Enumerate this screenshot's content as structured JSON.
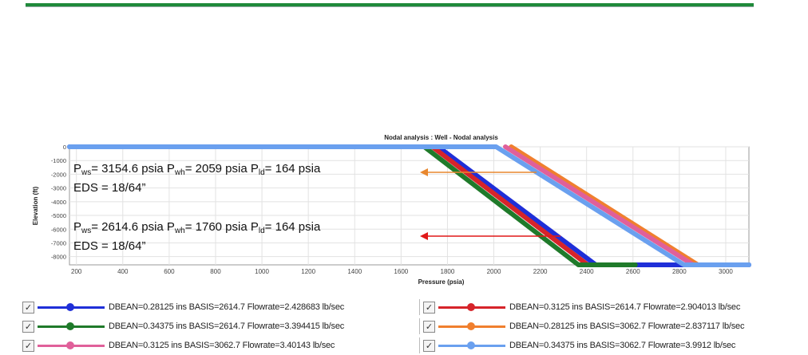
{
  "chart_data": {
    "type": "line",
    "title": "Nodal analysis : Well - Nodal analysis",
    "xlabel": "Pressure (psia)",
    "ylabel": "Elevation (ft)",
    "xlim": [
      170,
      3100
    ],
    "ylim": [
      -8600,
      0
    ],
    "x_ticks": [
      200,
      400,
      600,
      800,
      1000,
      1200,
      1400,
      1600,
      1800,
      2000,
      2200,
      2400,
      2600,
      2800,
      3000
    ],
    "y_ticks": [
      0,
      -1000,
      -2000,
      -3000,
      -4000,
      -5000,
      -6000,
      -7000,
      -8000
    ],
    "grid": true,
    "series": [
      {
        "name": "DBEAN=0.28125 ins BASIS=2614.7 Flowrate=2.428683 lb/sec",
        "color": "#1f2fd8",
        "x": [
          170,
          1760,
          2440,
          3100
        ],
        "y": [
          0,
          0,
          -8600,
          -8600
        ]
      },
      {
        "name": "DBEAN=0.3125 ins BASIS=2614.7 Flowrate=2.904013 lb/sec",
        "color": "#d6242a",
        "x": [
          1735,
          2405
        ],
        "y": [
          0,
          -8600
        ]
      },
      {
        "name": "DBEAN=0.34375 ins BASIS=2614.7 Flowrate=3.394415 lb/sec",
        "color": "#1f7a2a",
        "x": [
          1700,
          2365,
          2610
        ],
        "y": [
          0,
          -8600,
          -8600
        ]
      },
      {
        "name": "DBEAN=0.28125 ins BASIS=3062.7 Flowrate=2.837117 lb/sec",
        "color": "#f07f2e",
        "x": [
          2075,
          2880
        ],
        "y": [
          0,
          -8600
        ]
      },
      {
        "name": "DBEAN=0.3125 ins BASIS=3062.7 Flowrate=3.40143 lb/sec",
        "color": "#e0609a",
        "x": [
          2050,
          2860
        ],
        "y": [
          0,
          -8600
        ]
      },
      {
        "name": "DBEAN=0.34375 ins BASIS=3062.7 Flowrate=3.9912 lb/sec",
        "color": "#6aa0ef",
        "x": [
          170,
          2010,
          2820,
          3100
        ],
        "y": [
          0,
          0,
          -8600,
          -8600
        ]
      }
    ],
    "annotations": [
      {
        "lines": [
          [
            "P",
            "ws",
            "= 3154.6  psia   P",
            "wh",
            "= 2059 psia P",
            "ld",
            "= 164 psia"
          ],
          [
            "EDS = 18/64”"
          ]
        ],
        "arrow_color": "#e8872e"
      },
      {
        "lines": [
          [
            "P",
            "ws",
            "= 2614.6  psia   P",
            "wh",
            "= 1760 psia P",
            "ld",
            "= 164 psia"
          ],
          [
            "EDS = 18/64”"
          ]
        ],
        "arrow_color": "#e01818"
      }
    ]
  }
}
